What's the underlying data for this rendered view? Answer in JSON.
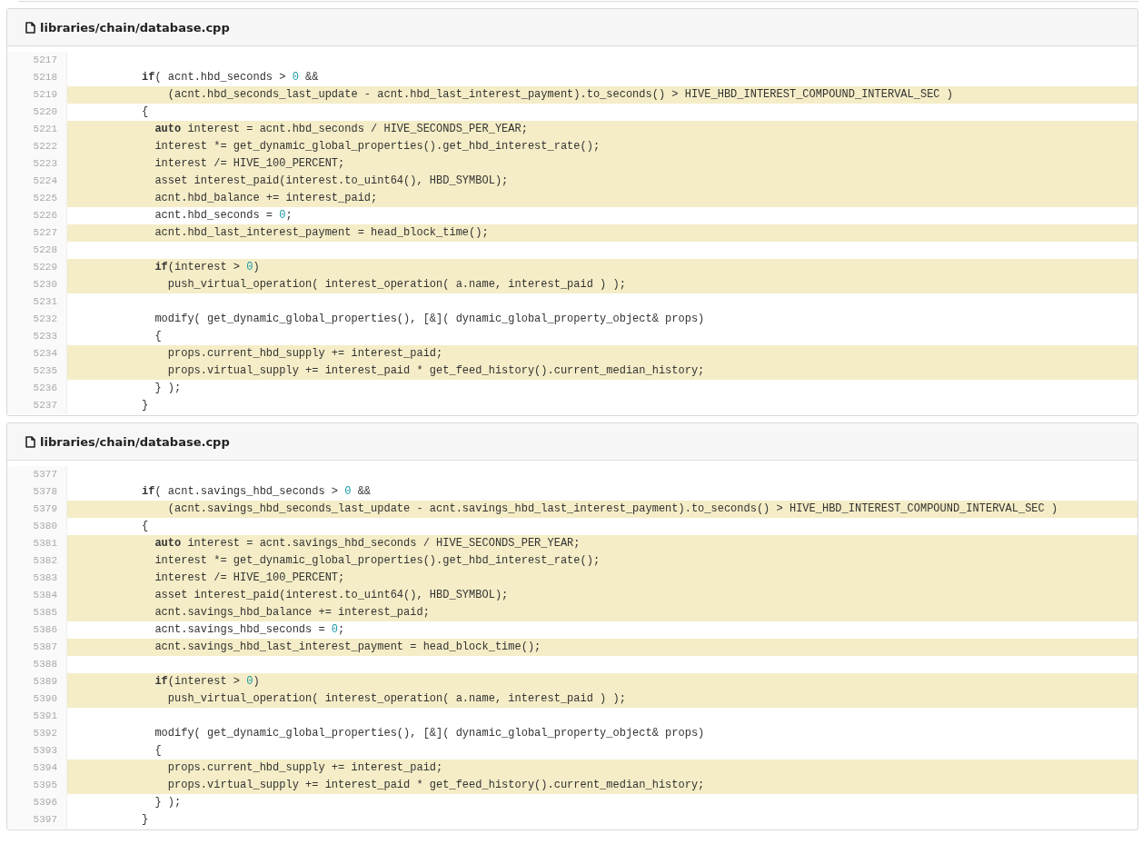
{
  "files": [
    {
      "path": "libraries/chain/database.cpp",
      "lines": [
        {
          "number": "5217",
          "highlighted": false
        },
        {
          "number": "5218",
          "highlighted": false,
          "segments": [
            {
              "kind": "keyword",
              "text": "          if"
            },
            {
              "kind": "plain",
              "text": "( acnt.hbd_seconds > "
            },
            {
              "kind": "number",
              "text": "0"
            },
            {
              "kind": "plain",
              "text": " &&"
            }
          ]
        },
        {
          "number": "5219",
          "highlighted": true,
          "segments": [
            {
              "kind": "plain",
              "text": "              (acnt.hbd_seconds_last_update - acnt.hbd_last_interest_payment).to_seconds() > HIVE_HBD_INTEREST_COMPOUND_INTERVAL_SEC )"
            }
          ]
        },
        {
          "number": "5220",
          "highlighted": false,
          "segments": [
            {
              "kind": "plain",
              "text": "          {"
            }
          ]
        },
        {
          "number": "5221",
          "highlighted": true,
          "segments": [
            {
              "kind": "keyword",
              "text": "            auto"
            },
            {
              "kind": "plain",
              "text": " interest = acnt.hbd_seconds / HIVE_SECONDS_PER_YEAR;"
            }
          ]
        },
        {
          "number": "5222",
          "highlighted": true,
          "segments": [
            {
              "kind": "plain",
              "text": "            interest *= get_dynamic_global_properties().get_hbd_interest_rate();"
            }
          ]
        },
        {
          "number": "5223",
          "highlighted": true,
          "segments": [
            {
              "kind": "plain",
              "text": "            interest /= HIVE_100_PERCENT;"
            }
          ]
        },
        {
          "number": "5224",
          "highlighted": true,
          "segments": [
            {
              "kind": "plain",
              "text": "            asset interest_paid(interest.to_uint64(), HBD_SYMBOL);"
            }
          ]
        },
        {
          "number": "5225",
          "highlighted": true,
          "segments": [
            {
              "kind": "plain",
              "text": "            acnt.hbd_balance += interest_paid;"
            }
          ]
        },
        {
          "number": "5226",
          "highlighted": false,
          "segments": [
            {
              "kind": "plain",
              "text": "            acnt.hbd_seconds = "
            },
            {
              "kind": "number",
              "text": "0"
            },
            {
              "kind": "plain",
              "text": ";"
            }
          ]
        },
        {
          "number": "5227",
          "highlighted": true,
          "segments": [
            {
              "kind": "plain",
              "text": "            acnt.hbd_last_interest_payment = head_block_time();"
            }
          ]
        },
        {
          "number": "5228",
          "highlighted": false
        },
        {
          "number": "5229",
          "highlighted": true,
          "segments": [
            {
              "kind": "keyword",
              "text": "            if"
            },
            {
              "kind": "plain",
              "text": "(interest > "
            },
            {
              "kind": "number",
              "text": "0"
            },
            {
              "kind": "plain",
              "text": ")"
            }
          ]
        },
        {
          "number": "5230",
          "highlighted": true,
          "segments": [
            {
              "kind": "plain",
              "text": "              push_virtual_operation( interest_operation( a.name, interest_paid ) );"
            }
          ]
        },
        {
          "number": "5231",
          "highlighted": false
        },
        {
          "number": "5232",
          "highlighted": false,
          "segments": [
            {
              "kind": "plain",
              "text": "            modify( get_dynamic_global_properties(), [&]( dynamic_global_property_object& props)"
            }
          ]
        },
        {
          "number": "5233",
          "highlighted": false,
          "segments": [
            {
              "kind": "plain",
              "text": "            {"
            }
          ]
        },
        {
          "number": "5234",
          "highlighted": true,
          "segments": [
            {
              "kind": "plain",
              "text": "              props.current_hbd_supply += interest_paid;"
            }
          ]
        },
        {
          "number": "5235",
          "highlighted": true,
          "segments": [
            {
              "kind": "plain",
              "text": "              props.virtual_supply += interest_paid * get_feed_history().current_median_history;"
            }
          ]
        },
        {
          "number": "5236",
          "highlighted": false,
          "segments": [
            {
              "kind": "plain",
              "text": "            } );"
            }
          ]
        },
        {
          "number": "5237",
          "highlighted": false,
          "segments": [
            {
              "kind": "plain",
              "text": "          }"
            }
          ]
        }
      ]
    },
    {
      "path": "libraries/chain/database.cpp",
      "lines": [
        {
          "number": "5377",
          "highlighted": false
        },
        {
          "number": "5378",
          "highlighted": false,
          "segments": [
            {
              "kind": "keyword",
              "text": "          if"
            },
            {
              "kind": "plain",
              "text": "( acnt.savings_hbd_seconds > "
            },
            {
              "kind": "number",
              "text": "0"
            },
            {
              "kind": "plain",
              "text": " &&"
            }
          ]
        },
        {
          "number": "5379",
          "highlighted": true,
          "segments": [
            {
              "kind": "plain",
              "text": "              (acnt.savings_hbd_seconds_last_update - acnt.savings_hbd_last_interest_payment).to_seconds() > HIVE_HBD_INTEREST_COMPOUND_INTERVAL_SEC )"
            }
          ]
        },
        {
          "number": "5380",
          "highlighted": false,
          "segments": [
            {
              "kind": "plain",
              "text": "          {"
            }
          ]
        },
        {
          "number": "5381",
          "highlighted": true,
          "segments": [
            {
              "kind": "keyword",
              "text": "            auto"
            },
            {
              "kind": "plain",
              "text": " interest = acnt.savings_hbd_seconds / HIVE_SECONDS_PER_YEAR;"
            }
          ]
        },
        {
          "number": "5382",
          "highlighted": true,
          "segments": [
            {
              "kind": "plain",
              "text": "            interest *= get_dynamic_global_properties().get_hbd_interest_rate();"
            }
          ]
        },
        {
          "number": "5383",
          "highlighted": true,
          "segments": [
            {
              "kind": "plain",
              "text": "            interest /= HIVE_100_PERCENT;"
            }
          ]
        },
        {
          "number": "5384",
          "highlighted": true,
          "segments": [
            {
              "kind": "plain",
              "text": "            asset interest_paid(interest.to_uint64(), HBD_SYMBOL);"
            }
          ]
        },
        {
          "number": "5385",
          "highlighted": true,
          "segments": [
            {
              "kind": "plain",
              "text": "            acnt.savings_hbd_balance += interest_paid;"
            }
          ]
        },
        {
          "number": "5386",
          "highlighted": false,
          "segments": [
            {
              "kind": "plain",
              "text": "            acnt.savings_hbd_seconds = "
            },
            {
              "kind": "number",
              "text": "0"
            },
            {
              "kind": "plain",
              "text": ";"
            }
          ]
        },
        {
          "number": "5387",
          "highlighted": true,
          "segments": [
            {
              "kind": "plain",
              "text": "            acnt.savings_hbd_last_interest_payment = head_block_time();"
            }
          ]
        },
        {
          "number": "5388",
          "highlighted": false
        },
        {
          "number": "5389",
          "highlighted": true,
          "segments": [
            {
              "kind": "keyword",
              "text": "            if"
            },
            {
              "kind": "plain",
              "text": "(interest > "
            },
            {
              "kind": "number",
              "text": "0"
            },
            {
              "kind": "plain",
              "text": ")"
            }
          ]
        },
        {
          "number": "5390",
          "highlighted": true,
          "segments": [
            {
              "kind": "plain",
              "text": "              push_virtual_operation( interest_operation( a.name, interest_paid ) );"
            }
          ]
        },
        {
          "number": "5391",
          "highlighted": false
        },
        {
          "number": "5392",
          "highlighted": false,
          "segments": [
            {
              "kind": "plain",
              "text": "            modify( get_dynamic_global_properties(), [&]( dynamic_global_property_object& props)"
            }
          ]
        },
        {
          "number": "5393",
          "highlighted": false,
          "segments": [
            {
              "kind": "plain",
              "text": "            {"
            }
          ]
        },
        {
          "number": "5394",
          "highlighted": true,
          "segments": [
            {
              "kind": "plain",
              "text": "              props.current_hbd_supply += interest_paid;"
            }
          ]
        },
        {
          "number": "5395",
          "highlighted": true,
          "segments": [
            {
              "kind": "plain",
              "text": "              props.virtual_supply += interest_paid * get_feed_history().current_median_history;"
            }
          ]
        },
        {
          "number": "5396",
          "highlighted": false,
          "segments": [
            {
              "kind": "plain",
              "text": "            } );"
            }
          ]
        },
        {
          "number": "5397",
          "highlighted": false,
          "segments": [
            {
              "kind": "plain",
              "text": "          }"
            }
          ]
        }
      ]
    }
  ]
}
